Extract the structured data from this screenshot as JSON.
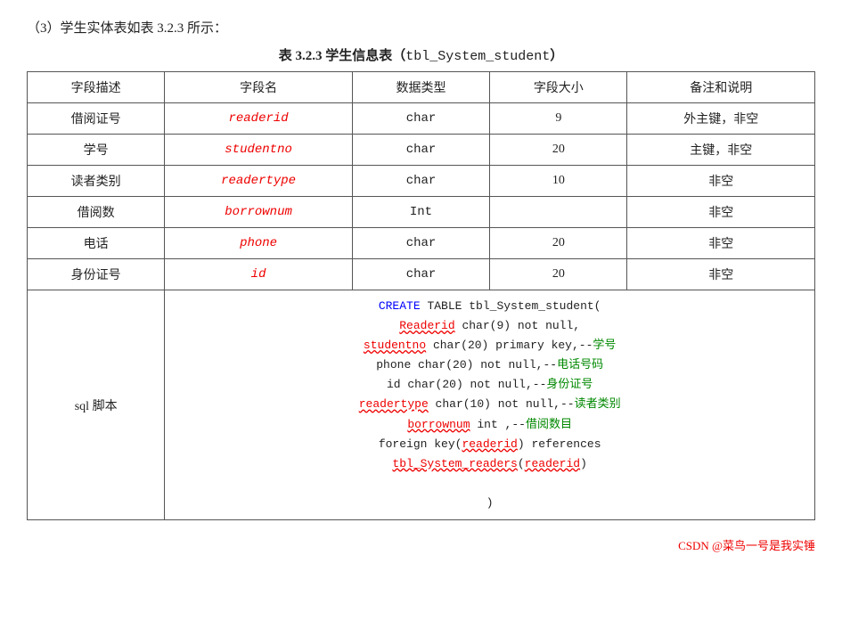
{
  "intro": {
    "text": "（3）学生实体表如表 3.2.3 所示："
  },
  "caption": {
    "text": "表 3.2.3  学生信息表（",
    "code": "tbl_System_student",
    "suffix": "）"
  },
  "table": {
    "headers": [
      "字段描述",
      "字段名",
      "数据类型",
      "字段大小",
      "备注和说明"
    ],
    "rows": [
      {
        "desc": "借阅证号",
        "field": "readerid",
        "type": "char",
        "size": "9",
        "note": "外主键，非空"
      },
      {
        "desc": "学号",
        "field": "studentno",
        "type": "char",
        "size": "20",
        "note": "主键，非空"
      },
      {
        "desc": "读者类别",
        "field": "readertype",
        "type": "char",
        "size": "10",
        "note": "非空"
      },
      {
        "desc": "借阅数",
        "field": "borrownum",
        "type": "Int",
        "size": "",
        "note": "非空"
      },
      {
        "desc": "电话",
        "field": "phone",
        "type": "char",
        "size": "20",
        "note": "非空"
      },
      {
        "desc": "身份证号",
        "field": "id",
        "type": "char",
        "size": "20",
        "note": "非空"
      }
    ],
    "sql_label": "sql 脚本"
  },
  "footer": {
    "text": "CSDN @菜鸟一号是我实锤"
  }
}
